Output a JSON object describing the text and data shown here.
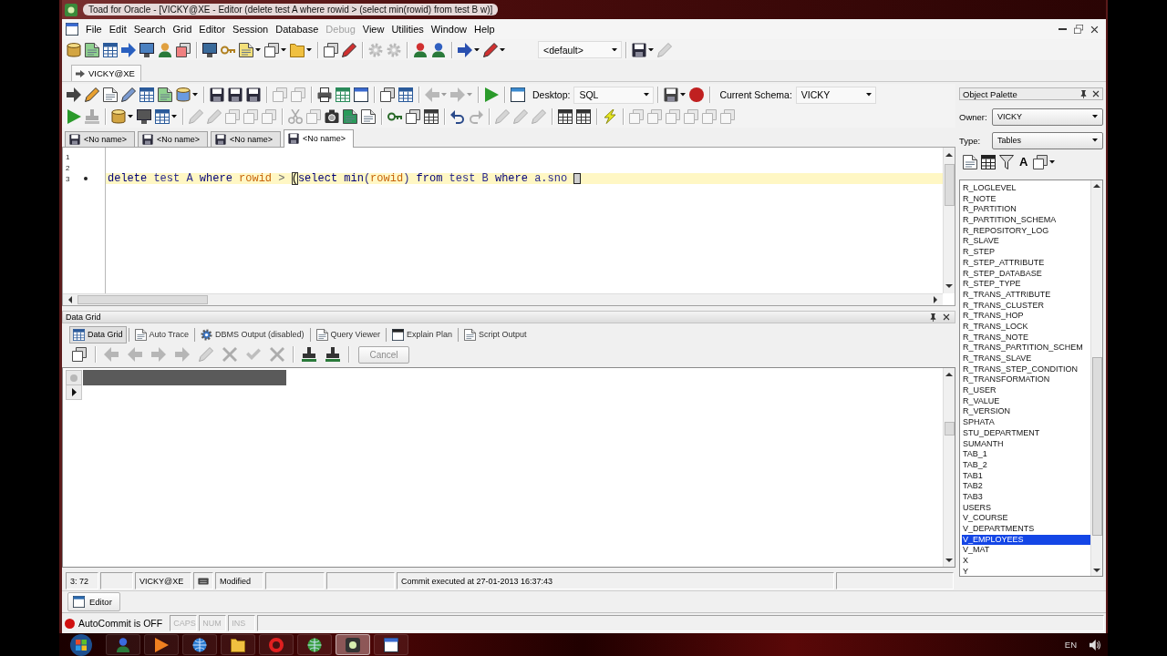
{
  "window": {
    "title": "Toad for Oracle - [VICKY@XE - Editor (delete test A where rowid > (select min(rowid) from test B w)]"
  },
  "menu_bar": [
    {
      "label": "File",
      "disabled": false
    },
    {
      "label": "Edit",
      "disabled": false
    },
    {
      "label": "Search",
      "disabled": false
    },
    {
      "label": "Grid",
      "disabled": false
    },
    {
      "label": "Editor",
      "disabled": false
    },
    {
      "label": "Session",
      "disabled": false
    },
    {
      "label": "Database",
      "disabled": false
    },
    {
      "label": "Debug",
      "disabled": true
    },
    {
      "label": "View",
      "disabled": false
    },
    {
      "label": "Utilities",
      "disabled": false
    },
    {
      "label": "Window",
      "disabled": false
    },
    {
      "label": "Help",
      "disabled": false
    }
  ],
  "main_toolbar": [
    {
      "kind": "icon",
      "disabled": false,
      "dropdown": false
    },
    {
      "kind": "icon",
      "disabled": false,
      "dropdown": false
    },
    {
      "kind": "icon",
      "disabled": false,
      "dropdown": false
    },
    {
      "kind": "icon",
      "disabled": false,
      "dropdown": false
    },
    {
      "kind": "icon",
      "disabled": false,
      "dropdown": false
    },
    {
      "kind": "icon",
      "disabled": false,
      "dropdown": false
    },
    {
      "kind": "icon",
      "disabled": false,
      "dropdown": false
    },
    {
      "kind": "separator"
    },
    {
      "kind": "icon",
      "disabled": false,
      "dropdown": false
    },
    {
      "kind": "icon",
      "disabled": false,
      "dropdown": false
    },
    {
      "kind": "icon",
      "disabled": false,
      "dropdown": true
    },
    {
      "kind": "icon",
      "disabled": false,
      "dropdown": true
    },
    {
      "kind": "icon",
      "disabled": false,
      "dropdown": true
    },
    {
      "kind": "separator"
    },
    {
      "kind": "icon",
      "disabled": false,
      "dropdown": false
    },
    {
      "kind": "icon",
      "disabled": false,
      "dropdown": false
    },
    {
      "kind": "separator"
    },
    {
      "kind": "icon",
      "disabled": true,
      "dropdown": false
    },
    {
      "kind": "icon",
      "disabled": true,
      "dropdown": false
    },
    {
      "kind": "separator"
    },
    {
      "kind": "icon",
      "disabled": false,
      "dropdown": false
    },
    {
      "kind": "icon",
      "disabled": false,
      "dropdown": false
    },
    {
      "kind": "separator"
    },
    {
      "kind": "icon",
      "disabled": false,
      "dropdown": true
    },
    {
      "kind": "icon",
      "disabled": false,
      "dropdown": true
    },
    {
      "kind": "combo",
      "value": "<default>"
    },
    {
      "kind": "separator"
    },
    {
      "kind": "icon",
      "disabled": false,
      "dropdown": true
    },
    {
      "kind": "icon",
      "disabled": true,
      "dropdown": false
    }
  ],
  "connection_bar": [
    {
      "label": "VICKY@XE"
    }
  ],
  "editor_toolbar": [
    {
      "kind": "icon",
      "disabled": false,
      "dropdown": false
    },
    {
      "kind": "icon",
      "disabled": false,
      "dropdown": false
    },
    {
      "kind": "icon",
      "disabled": false,
      "dropdown": false
    },
    {
      "kind": "icon",
      "disabled": false,
      "dropdown": false
    },
    {
      "kind": "icon",
      "disabled": false,
      "dropdown": false
    },
    {
      "kind": "icon",
      "disabled": false,
      "dropdown": false
    },
    {
      "kind": "icon",
      "disabled": false,
      "dropdown": true
    },
    {
      "kind": "separator"
    },
    {
      "kind": "icon",
      "disabled": false,
      "dropdown": false
    },
    {
      "kind": "icon",
      "disabled": false,
      "dropdown": false
    },
    {
      "kind": "icon",
      "disabled": false,
      "dropdown": false
    },
    {
      "kind": "separator"
    },
    {
      "kind": "icon",
      "disabled": true,
      "dropdown": false
    },
    {
      "kind": "icon",
      "disabled": true,
      "dropdown": false
    },
    {
      "kind": "separator"
    },
    {
      "kind": "icon",
      "disabled": false,
      "dropdown": false
    },
    {
      "kind": "icon",
      "disabled": false,
      "dropdown": false
    },
    {
      "kind": "icon",
      "disabled": false,
      "dropdown": false
    },
    {
      "kind": "separator"
    },
    {
      "kind": "icon",
      "disabled": false,
      "dropdown": false
    },
    {
      "kind": "icon",
      "disabled": false,
      "dropdown": false
    },
    {
      "kind": "separator"
    },
    {
      "kind": "icon",
      "disabled": true,
      "dropdown": true
    },
    {
      "kind": "icon",
      "disabled": true,
      "dropdown": true
    },
    {
      "kind": "separator"
    },
    {
      "kind": "icon",
      "disabled": false,
      "dropdown": false
    },
    {
      "kind": "separator"
    },
    {
      "kind": "icon",
      "disabled": false,
      "dropdown": false
    },
    {
      "kind": "combo",
      "label": "Desktop:",
      "value": "SQL"
    },
    {
      "kind": "separator"
    },
    {
      "kind": "icon",
      "disabled": false,
      "dropdown": true
    },
    {
      "kind": "icon",
      "disabled": false,
      "dropdown": false
    },
    {
      "kind": "separator"
    },
    {
      "kind": "combo",
      "label": "Current Schema:",
      "value": "VICKY"
    }
  ],
  "edit_toolbar": [
    {
      "kind": "icon",
      "disabled": false,
      "dropdown": false
    },
    {
      "kind": "icon",
      "disabled": true,
      "dropdown": false
    },
    {
      "kind": "separator"
    },
    {
      "kind": "icon",
      "disabled": false,
      "dropdown": true
    },
    {
      "kind": "icon",
      "disabled": false,
      "dropdown": false
    },
    {
      "kind": "icon",
      "disabled": false,
      "dropdown": true
    },
    {
      "kind": "separator"
    },
    {
      "kind": "icon",
      "disabled": true,
      "dropdown": false
    },
    {
      "kind": "icon",
      "disabled": true,
      "dropdown": false
    },
    {
      "kind": "icon",
      "disabled": true,
      "dropdown": false
    },
    {
      "kind": "icon",
      "disabled": true,
      "dropdown": false
    },
    {
      "kind": "icon",
      "disabled": true,
      "dropdown": false
    },
    {
      "kind": "separator"
    },
    {
      "kind": "icon",
      "disabled": true,
      "dropdown": false
    },
    {
      "kind": "icon",
      "disabled": true,
      "dropdown": false
    },
    {
      "kind": "icon",
      "disabled": false,
      "dropdown": false
    },
    {
      "kind": "icon",
      "disabled": false,
      "dropdown": false
    },
    {
      "kind": "icon",
      "disabled": false,
      "dropdown": false
    },
    {
      "kind": "separator"
    },
    {
      "kind": "icon",
      "disabled": false,
      "dropdown": false
    },
    {
      "kind": "icon",
      "disabled": false,
      "dropdown": false
    },
    {
      "kind": "icon",
      "disabled": false,
      "dropdown": false
    },
    {
      "kind": "separator"
    },
    {
      "kind": "icon",
      "disabled": false,
      "dropdown": false
    },
    {
      "kind": "icon",
      "disabled": true,
      "dropdown": false
    },
    {
      "kind": "separator"
    },
    {
      "kind": "icon",
      "disabled": true,
      "dropdown": false
    },
    {
      "kind": "icon",
      "disabled": true,
      "dropdown": false
    },
    {
      "kind": "icon",
      "disabled": true,
      "dropdown": false
    },
    {
      "kind": "separator"
    },
    {
      "kind": "icon",
      "disabled": false,
      "dropdown": false
    },
    {
      "kind": "icon",
      "disabled": false,
      "dropdown": false
    },
    {
      "kind": "separator"
    },
    {
      "kind": "icon",
      "disabled": false,
      "dropdown": false
    },
    {
      "kind": "separator"
    },
    {
      "kind": "icon",
      "disabled": true,
      "dropdown": false
    },
    {
      "kind": "icon",
      "disabled": true,
      "dropdown": false
    },
    {
      "kind": "icon",
      "disabled": true,
      "dropdown": false
    },
    {
      "kind": "icon",
      "disabled": true,
      "dropdown": false
    },
    {
      "kind": "icon",
      "disabled": true,
      "dropdown": false
    },
    {
      "kind": "icon",
      "disabled": true,
      "dropdown": false
    }
  ],
  "editor": {
    "tabs": [
      {
        "label": "<No name>",
        "selected": false
      },
      {
        "label": "<No name>",
        "selected": false
      },
      {
        "label": "<No name>",
        "selected": false
      },
      {
        "label": "<No name>",
        "selected": true
      }
    ],
    "lines": [
      {
        "number": "1",
        "current": false,
        "marker": false,
        "cursor": false
      },
      {
        "number": "2",
        "current": false,
        "marker": false,
        "cursor": false
      },
      {
        "number": "3",
        "current": true,
        "marker": true,
        "cursor": true,
        "tokens": [
          {
            "kind": "keyword",
            "text": "delete"
          },
          {
            "kind": "plain",
            "text": " test A "
          },
          {
            "kind": "keyword",
            "text": "where"
          },
          {
            "kind": "pseudo",
            "text": " rowid"
          },
          {
            "kind": "operator",
            "text": " > "
          },
          {
            "kind": "bracket",
            "text": "("
          },
          {
            "kind": "keyword",
            "text": "select "
          },
          {
            "kind": "function",
            "text": "min"
          },
          {
            "kind": "plain",
            "text": "("
          },
          {
            "kind": "pseudo",
            "text": "rowid"
          },
          {
            "kind": "plain",
            "text": ") "
          },
          {
            "kind": "keyword",
            "text": "from"
          },
          {
            "kind": "plain",
            "text": " test B "
          },
          {
            "kind": "keyword",
            "text": "where"
          },
          {
            "kind": "plain",
            "text": " a.sno "
          }
        ]
      }
    ]
  },
  "results": {
    "title": "Data Grid",
    "tabs": [
      {
        "label": "Data Grid",
        "selected": true
      },
      {
        "label": "Auto Trace",
        "selected": false
      },
      {
        "label": "DBMS Output (disabled)",
        "selected": false
      },
      {
        "label": "Query Viewer",
        "selected": false
      },
      {
        "label": "Explain Plan",
        "selected": false
      },
      {
        "label": "Script Output",
        "selected": false
      }
    ],
    "toolbar": [
      {
        "kind": "icon",
        "disabled": false,
        "dropdown": false
      },
      {
        "kind": "separator"
      },
      {
        "kind": "icon",
        "disabled": true,
        "dropdown": false
      },
      {
        "kind": "icon",
        "disabled": true,
        "dropdown": false
      },
      {
        "kind": "icon",
        "disabled": true,
        "dropdown": false
      },
      {
        "kind": "icon",
        "disabled": true,
        "dropdown": false
      },
      {
        "kind": "icon",
        "disabled": true,
        "dropdown": false
      },
      {
        "kind": "icon",
        "disabled": true,
        "dropdown": false
      },
      {
        "kind": "icon",
        "disabled": true,
        "dropdown": false
      },
      {
        "kind": "icon",
        "disabled": true,
        "dropdown": false
      },
      {
        "kind": "separator"
      },
      {
        "kind": "icon",
        "disabled": false,
        "dropdown": false
      },
      {
        "kind": "icon",
        "disabled": false,
        "dropdown": false
      },
      {
        "kind": "separator"
      },
      {
        "kind": "button",
        "label": "Cancel",
        "disabled": true
      }
    ],
    "grid": {
      "rows": [
        {
          "current": true
        }
      ]
    }
  },
  "status_bar": {
    "position": "3: 72",
    "connection": "VICKY@XE",
    "state": "Modified",
    "message": "Commit executed at 27-01-2013 16:37:43"
  },
  "object_palette": {
    "title": "Object Palette",
    "owner": {
      "label": "Owner:",
      "value": "VICKY"
    },
    "type": {
      "label": "Type:",
      "value": "Tables"
    },
    "tools": [
      {
        "kind": "icon",
        "disabled": false,
        "dropdown": false
      },
      {
        "kind": "icon",
        "disabled": false,
        "dropdown": false
      },
      {
        "kind": "icon",
        "disabled": false,
        "dropdown": false
      },
      {
        "kind": "glyph",
        "text": "A"
      },
      {
        "kind": "icon",
        "disabled": false,
        "dropdown": true
      }
    ],
    "objects": [
      {
        "name": "R_LOGLEVEL",
        "selected": false
      },
      {
        "name": "R_NOTE",
        "selected": false
      },
      {
        "name": "R_PARTITION",
        "selected": false
      },
      {
        "name": "R_PARTITION_SCHEMA",
        "selected": false
      },
      {
        "name": "R_REPOSITORY_LOG",
        "selected": false
      },
      {
        "name": "R_SLAVE",
        "selected": false
      },
      {
        "name": "R_STEP",
        "selected": false
      },
      {
        "name": "R_STEP_ATTRIBUTE",
        "selected": false
      },
      {
        "name": "R_STEP_DATABASE",
        "selected": false
      },
      {
        "name": "R_STEP_TYPE",
        "selected": false
      },
      {
        "name": "R_TRANS_ATTRIBUTE",
        "selected": false
      },
      {
        "name": "R_TRANS_CLUSTER",
        "selected": false
      },
      {
        "name": "R_TRANS_HOP",
        "selected": false
      },
      {
        "name": "R_TRANS_LOCK",
        "selected": false
      },
      {
        "name": "R_TRANS_NOTE",
        "selected": false
      },
      {
        "name": "R_TRANS_PARTITION_SCHEM",
        "selected": false
      },
      {
        "name": "R_TRANS_SLAVE",
        "selected": false
      },
      {
        "name": "R_TRANS_STEP_CONDITION",
        "selected": false
      },
      {
        "name": "R_TRANSFORMATION",
        "selected": false
      },
      {
        "name": "R_USER",
        "selected": false
      },
      {
        "name": "R_VALUE",
        "selected": false
      },
      {
        "name": "R_VERSION",
        "selected": false
      },
      {
        "name": "SPHATA",
        "selected": false
      },
      {
        "name": "STU_DEPARTMENT",
        "selected": false
      },
      {
        "name": "SUMANTH",
        "selected": false
      },
      {
        "name": "TAB_1",
        "selected": false
      },
      {
        "name": "TAB_2",
        "selected": false
      },
      {
        "name": "TAB1",
        "selected": false
      },
      {
        "name": "TAB2",
        "selected": false
      },
      {
        "name": "TAB3",
        "selected": false
      },
      {
        "name": "USERS",
        "selected": false
      },
      {
        "name": "V_COURSE",
        "selected": false
      },
      {
        "name": "V_DEPARTMENTS",
        "selected": false
      },
      {
        "name": "V_EMPLOYEES",
        "selected": true
      },
      {
        "name": "V_MAT",
        "selected": false
      },
      {
        "name": "X",
        "selected": false
      },
      {
        "name": "Y",
        "selected": false
      }
    ]
  },
  "window_bar": [
    {
      "label": "Editor"
    }
  ],
  "bottom_bar": {
    "autocommit": {
      "label": "AutoCommit is OFF",
      "on": false
    },
    "keys": [
      {
        "label": "CAPS",
        "on": false
      },
      {
        "label": "NUM",
        "on": false
      },
      {
        "label": "INS",
        "on": false
      }
    ]
  },
  "taskbar": {
    "apps": [
      {
        "active": false
      },
      {
        "active": false
      },
      {
        "active": false
      },
      {
        "active": false
      },
      {
        "active": false
      },
      {
        "active": false
      },
      {
        "active": true
      },
      {
        "active": false
      }
    ],
    "language": "EN"
  }
}
